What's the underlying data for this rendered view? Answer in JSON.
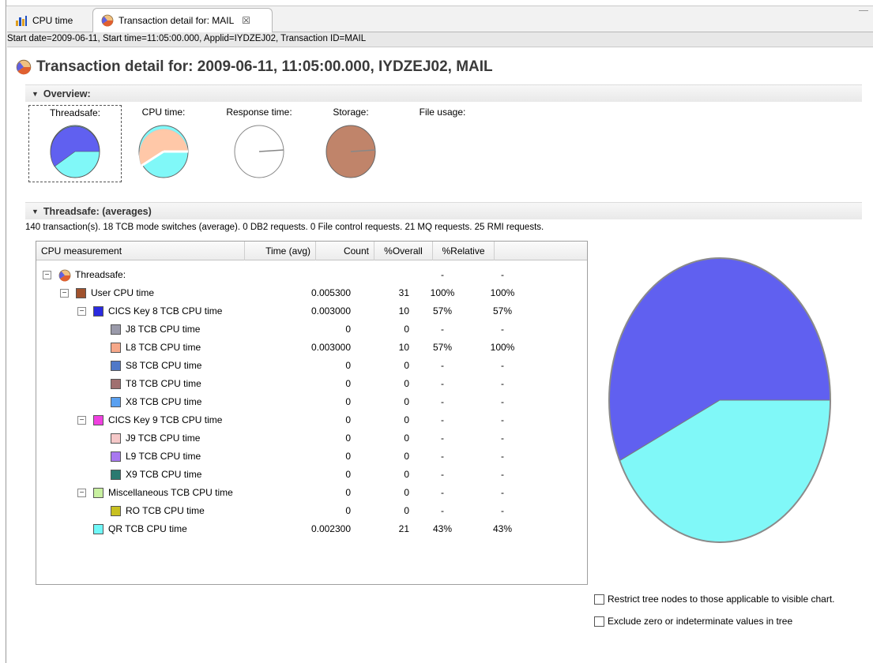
{
  "tabs": [
    {
      "label": "CPU time",
      "icon": "bar-chart-icon"
    },
    {
      "label": "Transaction detail for: MAIL",
      "icon": "pie-chart-icon",
      "close": "☒"
    }
  ],
  "infobar": "Start date=2009-06-11, Start time=11:05:00.000, Applid=IYDZEJ02, Transaction ID=MAIL",
  "title": "Transaction detail for: 2009-06-11, 11:05:00.000, IYDZEJ02, MAIL",
  "overview": {
    "heading": "Overview:",
    "items": [
      {
        "label": "Threadsafe:"
      },
      {
        "label": "CPU time:"
      },
      {
        "label": "Response time:"
      },
      {
        "label": "Storage:"
      },
      {
        "label": "File usage:"
      }
    ]
  },
  "threadsafe": {
    "heading": "Threadsafe: (averages)",
    "summary": "140 transaction(s). 18 TCB mode switches (average). 0 DB2 requests. 0 File control requests. 21 MQ requests. 25 RMI requests."
  },
  "table": {
    "columns": [
      "CPU measurement",
      "Time (avg)",
      "Count",
      "%Overall",
      "%Relative"
    ],
    "rows": [
      {
        "name": "Threadsafe:",
        "time": "",
        "count": "",
        "overall": "-",
        "relative": "-",
        "color": "",
        "level": 0,
        "expander": "⊟",
        "root": true
      },
      {
        "name": "User CPU time",
        "time": "0.005300",
        "count": "31",
        "overall": "100%",
        "relative": "100%",
        "color": "#a0522d",
        "level": 1,
        "expander": "⊟"
      },
      {
        "name": "CICS Key 8 TCB CPU time",
        "time": "0.003000",
        "count": "10",
        "overall": "57%",
        "relative": "57%",
        "color": "#2a2ae0",
        "level": 2,
        "expander": "⊟"
      },
      {
        "name": "J8 TCB CPU time",
        "time": "0",
        "count": "0",
        "overall": "-",
        "relative": "-",
        "color": "#9a9aaa",
        "level": 3,
        "expander": ""
      },
      {
        "name": "L8 TCB CPU time",
        "time": "0.003000",
        "count": "10",
        "overall": "57%",
        "relative": "100%",
        "color": "#f6a88a",
        "level": 3,
        "expander": ""
      },
      {
        "name": "S8 TCB CPU time",
        "time": "0",
        "count": "0",
        "overall": "-",
        "relative": "-",
        "color": "#4f78c8",
        "level": 3,
        "expander": ""
      },
      {
        "name": "T8 TCB CPU time",
        "time": "0",
        "count": "0",
        "overall": "-",
        "relative": "-",
        "color": "#a07070",
        "level": 3,
        "expander": ""
      },
      {
        "name": "X8 TCB CPU time",
        "time": "0",
        "count": "0",
        "overall": "-",
        "relative": "-",
        "color": "#5aa0f0",
        "level": 3,
        "expander": ""
      },
      {
        "name": "CICS Key 9 TCB CPU time",
        "time": "0",
        "count": "0",
        "overall": "-",
        "relative": "-",
        "color": "#f040e0",
        "level": 2,
        "expander": "⊟"
      },
      {
        "name": "J9 TCB CPU time",
        "time": "0",
        "count": "0",
        "overall": "-",
        "relative": "-",
        "color": "#f5c8c8",
        "level": 3,
        "expander": ""
      },
      {
        "name": "L9 TCB CPU time",
        "time": "0",
        "count": "0",
        "overall": "-",
        "relative": "-",
        "color": "#a878f0",
        "level": 3,
        "expander": ""
      },
      {
        "name": "X9 TCB CPU time",
        "time": "0",
        "count": "0",
        "overall": "-",
        "relative": "-",
        "color": "#2a7a70",
        "level": 3,
        "expander": ""
      },
      {
        "name": "Miscellaneous TCB CPU time",
        "time": "0",
        "count": "0",
        "overall": "-",
        "relative": "-",
        "color": "#c8f0a0",
        "level": 2,
        "expander": "⊟"
      },
      {
        "name": "RO TCB CPU time",
        "time": "0",
        "count": "0",
        "overall": "-",
        "relative": "-",
        "color": "#c8c020",
        "level": 3,
        "expander": ""
      },
      {
        "name": "QR TCB CPU time",
        "time": "0.002300",
        "count": "21",
        "overall": "43%",
        "relative": "43%",
        "color": "#70f8f8",
        "level": 2,
        "expander": ""
      }
    ]
  },
  "chart_data": {
    "type": "pie",
    "categories": [
      "CICS Key 8 TCB CPU time",
      "QR TCB CPU time"
    ],
    "values": [
      57,
      43
    ],
    "colors": [
      "#6060f0",
      "#80f8f8"
    ]
  },
  "options": {
    "restrict": "Restrict tree nodes to those applicable to visible chart.",
    "exclude": "Exclude zero or indeterminate values in tree"
  }
}
